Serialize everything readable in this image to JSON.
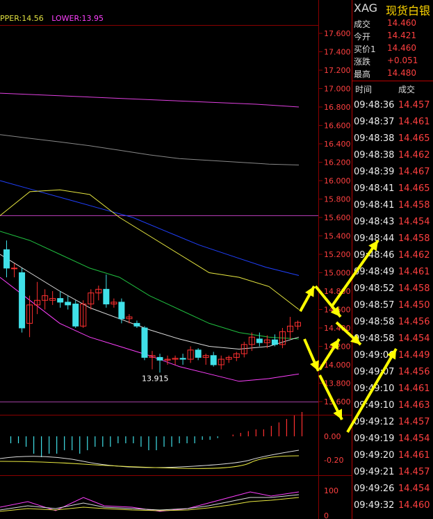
{
  "legend": {
    "upper": "PPER:14.56",
    "lower": "LOWER:13.95"
  },
  "annotation": {
    "low_label": "13.915"
  },
  "chart_data": {
    "type": "candlestick",
    "yticks": [
      "17.600",
      "17.400",
      "17.200",
      "17.000",
      "16.800",
      "16.600",
      "16.400",
      "16.200",
      "16.000",
      "15.800",
      "15.600",
      "15.400",
      "15.200",
      "15.000",
      "14.800",
      "14.600",
      "14.400",
      "14.200",
      "14.000",
      "13.800",
      "13.600"
    ],
    "ylim": [
      13.6,
      17.6
    ],
    "line_ref_price": 15.62,
    "candles": [
      {
        "o": 15.25,
        "h": 15.35,
        "l": 14.95,
        "c": 15.05
      },
      {
        "o": 15.05,
        "h": 15.1,
        "l": 14.95,
        "c": 15.05
      },
      {
        "o": 15.0,
        "h": 15.05,
        "l": 14.35,
        "c": 14.4
      },
      {
        "o": 14.45,
        "h": 14.75,
        "l": 14.3,
        "c": 14.65
      },
      {
        "o": 14.65,
        "h": 14.9,
        "l": 14.55,
        "c": 14.7
      },
      {
        "o": 14.7,
        "h": 14.82,
        "l": 14.6,
        "c": 14.75
      },
      {
        "o": 14.7,
        "h": 14.8,
        "l": 14.65,
        "c": 14.72
      },
      {
        "o": 14.72,
        "h": 14.8,
        "l": 14.62,
        "c": 14.68
      },
      {
        "o": 14.68,
        "h": 14.75,
        "l": 14.6,
        "c": 14.65
      },
      {
        "o": 14.66,
        "h": 14.7,
        "l": 14.4,
        "c": 14.42
      },
      {
        "o": 14.42,
        "h": 14.7,
        "l": 14.4,
        "c": 14.66
      },
      {
        "o": 14.66,
        "h": 14.82,
        "l": 14.6,
        "c": 14.78
      },
      {
        "o": 14.78,
        "h": 14.86,
        "l": 14.7,
        "c": 14.82
      },
      {
        "o": 14.82,
        "h": 14.98,
        "l": 14.62,
        "c": 14.66
      },
      {
        "o": 14.66,
        "h": 14.72,
        "l": 14.62,
        "c": 14.68
      },
      {
        "o": 14.68,
        "h": 14.72,
        "l": 14.45,
        "c": 14.5
      },
      {
        "o": 14.5,
        "h": 14.55,
        "l": 14.45,
        "c": 14.52
      },
      {
        "o": 14.45,
        "h": 14.48,
        "l": 14.4,
        "c": 14.42
      },
      {
        "o": 14.4,
        "h": 14.42,
        "l": 14.05,
        "c": 14.08
      },
      {
        "o": 14.08,
        "h": 14.15,
        "l": 13.95,
        "c": 14.1
      },
      {
        "o": 14.08,
        "h": 14.12,
        "l": 13.915,
        "c": 14.05
      },
      {
        "o": 14.05,
        "h": 14.1,
        "l": 14.0,
        "c": 14.06
      },
      {
        "o": 14.06,
        "h": 14.1,
        "l": 14.0,
        "c": 14.07
      },
      {
        "o": 14.07,
        "h": 14.12,
        "l": 14.0,
        "c": 14.06
      },
      {
        "o": 14.06,
        "h": 14.2,
        "l": 14.02,
        "c": 14.16
      },
      {
        "o": 14.16,
        "h": 14.18,
        "l": 14.05,
        "c": 14.08
      },
      {
        "o": 14.08,
        "h": 14.12,
        "l": 14.0,
        "c": 14.1
      },
      {
        "o": 14.1,
        "h": 14.14,
        "l": 13.98,
        "c": 14.0
      },
      {
        "o": 14.0,
        "h": 14.1,
        "l": 13.95,
        "c": 14.06
      },
      {
        "o": 14.06,
        "h": 14.1,
        "l": 14.02,
        "c": 14.08
      },
      {
        "o": 14.08,
        "h": 14.14,
        "l": 14.04,
        "c": 14.12
      },
      {
        "o": 14.12,
        "h": 14.25,
        "l": 14.08,
        "c": 14.22
      },
      {
        "o": 14.22,
        "h": 14.35,
        "l": 14.15,
        "c": 14.3
      },
      {
        "o": 14.28,
        "h": 14.35,
        "l": 14.2,
        "c": 14.24
      },
      {
        "o": 14.24,
        "h": 14.32,
        "l": 14.18,
        "c": 14.27
      },
      {
        "o": 14.27,
        "h": 14.33,
        "l": 14.2,
        "c": 14.22
      },
      {
        "o": 14.22,
        "h": 14.4,
        "l": 14.18,
        "c": 14.36
      },
      {
        "o": 14.36,
        "h": 14.52,
        "l": 14.28,
        "c": 14.42
      },
      {
        "o": 14.42,
        "h": 14.48,
        "l": 14.38,
        "c": 14.46
      }
    ],
    "macd_ticks": [
      "0.00",
      "-0.20"
    ],
    "macd_hist": [
      -0.02,
      -0.02,
      -0.03,
      -0.05,
      -0.06,
      -0.05,
      -0.05,
      -0.04,
      -0.04,
      -0.05,
      -0.04,
      -0.03,
      -0.03,
      -0.03,
      -0.02,
      -0.02,
      -0.02,
      -0.03,
      -0.04,
      -0.04,
      -0.03,
      -0.03,
      -0.02,
      -0.02,
      -0.02,
      -0.01,
      -0.01,
      -0.005,
      0.0,
      0.005,
      0.01,
      0.015,
      0.02,
      0.02,
      0.03,
      0.04,
      0.05,
      0.06,
      0.07
    ],
    "kdj_ticks": [
      "100",
      "0"
    ]
  },
  "panel": {
    "symbol": "XAG",
    "name": "现货白银",
    "quote": [
      {
        "k": "成交",
        "v": "14.460"
      },
      {
        "k": "今开",
        "v": "14.421"
      },
      {
        "k": "买价1",
        "v": "14.460"
      },
      {
        "k": "涨跌",
        "v": "+0.051"
      },
      {
        "k": "最高",
        "v": "14.480"
      }
    ],
    "header_time": "时间",
    "header_price": "成交",
    "ticks": [
      {
        "t": "09:48:36",
        "p": "14.457"
      },
      {
        "t": "09:48:37",
        "p": "14.461"
      },
      {
        "t": "09:48:38",
        "p": "14.465"
      },
      {
        "t": "09:48:38",
        "p": "14.462"
      },
      {
        "t": "09:48:39",
        "p": "14.467"
      },
      {
        "t": "09:48:41",
        "p": "14.465"
      },
      {
        "t": "09:48:41",
        "p": "14.458"
      },
      {
        "t": "09:48:43",
        "p": "14.454"
      },
      {
        "t": "09:48:44",
        "p": "14.458"
      },
      {
        "t": "09:48:46",
        "p": "14.462"
      },
      {
        "t": "09:48:49",
        "p": "14.461"
      },
      {
        "t": "09:48:52",
        "p": "14.458"
      },
      {
        "t": "09:48:57",
        "p": "14.450"
      },
      {
        "t": "09:48:58",
        "p": "14.456"
      },
      {
        "t": "09:48:58",
        "p": "14.454"
      },
      {
        "t": "09:49:06",
        "p": "14.449"
      },
      {
        "t": "09:49:07",
        "p": "14.456"
      },
      {
        "t": "09:49:10",
        "p": "14.461"
      },
      {
        "t": "09:49:10",
        "p": "14.463"
      },
      {
        "t": "09:49:12",
        "p": "14.457"
      },
      {
        "t": "09:49:19",
        "p": "14.454"
      },
      {
        "t": "09:49:20",
        "p": "14.461"
      },
      {
        "t": "09:49:21",
        "p": "14.457"
      },
      {
        "t": "09:49:26",
        "p": "14.454"
      },
      {
        "t": "09:49:32",
        "p": "14.460"
      }
    ]
  },
  "colors": {
    "up": "#ff3030",
    "down": "#40e0e8",
    "grid": "#8b0000",
    "axis_text": "#ff4040",
    "ma_yellow": "#e8e840",
    "ma_green": "#20c040",
    "ma_blue": "#2040ff",
    "ma_magenta": "#ff40ff",
    "arrow": "#ffff00"
  }
}
